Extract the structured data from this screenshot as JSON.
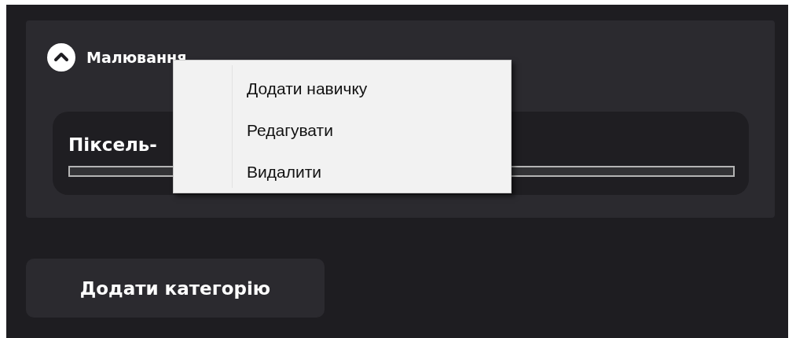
{
  "category": {
    "title": "Малювання",
    "expanded": true,
    "skills": [
      {
        "name": "Піксель-"
      }
    ]
  },
  "context_menu": {
    "items": [
      {
        "label": "Додати навичку"
      },
      {
        "label": "Редагувати"
      },
      {
        "label": "Видалити"
      }
    ]
  },
  "add_button": {
    "label": "Додати категорію"
  }
}
